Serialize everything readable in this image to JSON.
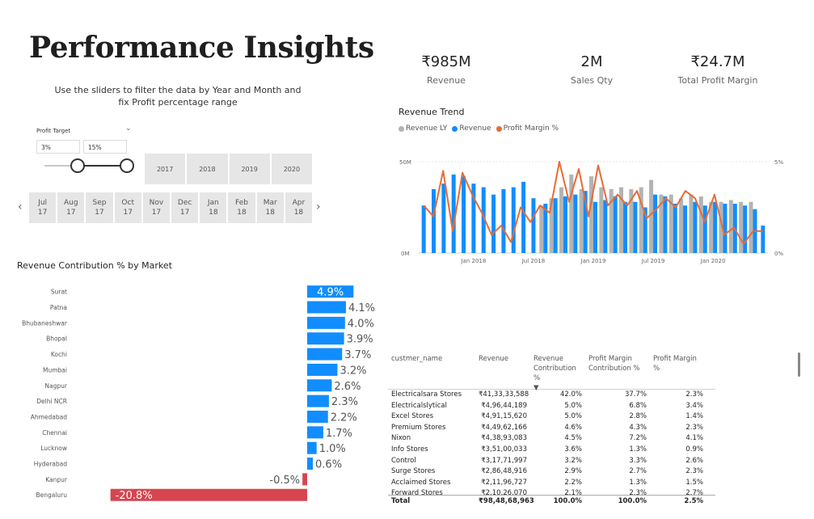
{
  "header": {
    "title": "Performance Insights",
    "instructions": "Use the sliders to filter the data by Year and Month and fix Profit percentage range"
  },
  "profit_target": {
    "label": "Profit Target",
    "min_value": "3%",
    "max_value": "15%"
  },
  "years": [
    "2017",
    "2018",
    "2019",
    "2020"
  ],
  "months": [
    {
      "m": "Jul",
      "y": "17"
    },
    {
      "m": "Aug",
      "y": "17"
    },
    {
      "m": "Sep",
      "y": "17"
    },
    {
      "m": "Oct",
      "y": "17"
    },
    {
      "m": "Nov",
      "y": "17"
    },
    {
      "m": "Dec",
      "y": "17"
    },
    {
      "m": "Jan",
      "y": "18"
    },
    {
      "m": "Feb",
      "y": "18"
    },
    {
      "m": "Mar",
      "y": "18"
    },
    {
      "m": "Apr",
      "y": "18"
    }
  ],
  "kpis": [
    {
      "value": "₹985M",
      "label": "Revenue"
    },
    {
      "value": "2M",
      "label": "Sales Qty"
    },
    {
      "value": "₹24.7M",
      "label": "Total Profit Margin"
    }
  ],
  "colors": {
    "revenue_ly": "#b3b3b3",
    "revenue": "#118dff",
    "profit_margin": "#e66c37",
    "negative": "#d64550",
    "positive": "#118dff"
  },
  "chart_data": [
    {
      "type": "bar",
      "title": "Revenue Trend",
      "legend": [
        "Revenue LY",
        "Revenue",
        "Profit Margin %"
      ],
      "legend_position": "top-left",
      "y_ticks_left": [
        "50M",
        "0M"
      ],
      "y_ticks_right": [
        "5%",
        "0%"
      ],
      "ylim": [
        0,
        50
      ],
      "ylim_right": [
        0,
        5
      ],
      "x_ticks": [
        "Jan 2018",
        "Jul 2018",
        "Jan 2019",
        "Jul 2019",
        "Jan 2020"
      ],
      "x_tick_index": [
        5,
        11,
        17,
        23,
        29
      ],
      "series": [
        {
          "name": "Revenue LY",
          "values": [
            null,
            null,
            null,
            null,
            null,
            null,
            null,
            null,
            null,
            null,
            null,
            null,
            26,
            30,
            36,
            43,
            35,
            42,
            36,
            35,
            36,
            35,
            36,
            40,
            32,
            32,
            30,
            32,
            31,
            28,
            28,
            29,
            28,
            28,
            null
          ]
        },
        {
          "name": "Revenue",
          "values": [
            26,
            35,
            38,
            43,
            42,
            38,
            36,
            32,
            35,
            36,
            39,
            30,
            27,
            30,
            31,
            32,
            34,
            28,
            29,
            31,
            28,
            28,
            25,
            32,
            31,
            27,
            26,
            28,
            26,
            28,
            27,
            27,
            26,
            24,
            15
          ]
        },
        {
          "name": "Profit Margin %",
          "values": [
            2.6,
            2.0,
            4.5,
            1.2,
            4.4,
            3.2,
            2.2,
            1.0,
            1.5,
            0.6,
            2.5,
            1.7,
            2.6,
            2.2,
            5.0,
            2.8,
            4.6,
            2.0,
            4.8,
            2.6,
            3.2,
            2.6,
            3.4,
            1.9,
            2.4,
            3.0,
            2.5,
            3.4,
            3.0,
            1.7,
            3.2,
            1.0,
            1.4,
            0.5,
            1.2,
            1.2
          ]
        }
      ]
    },
    {
      "type": "bar",
      "title": "Revenue Contribution % by Market",
      "categories": [
        "Surat",
        "Patna",
        "Bhubaneshwar",
        "Bhopal",
        "Kochi",
        "Mumbai",
        "Nagpur",
        "Delhi NCR",
        "Ahmedabad",
        "Chennai",
        "Lucknow",
        "Hyderabad",
        "Kanpur",
        "Bengaluru"
      ],
      "values": [
        4.9,
        4.1,
        4.0,
        3.9,
        3.7,
        3.2,
        2.6,
        2.3,
        2.2,
        1.7,
        1.0,
        0.6,
        -0.5,
        -20.8
      ],
      "labels": [
        "4.9%",
        "4.1%",
        "4.0%",
        "3.9%",
        "3.7%",
        "3.2%",
        "2.6%",
        "2.3%",
        "2.2%",
        "1.7%",
        "1.0%",
        "0.6%",
        "-0.5%",
        "-20.8%"
      ]
    }
  ],
  "table": {
    "columns": [
      "custmer_name",
      "Revenue",
      "Revenue Contribution %",
      "Profit Margin Contribution %",
      "Profit Margin %"
    ],
    "sort_indicator": "▼",
    "rows": [
      [
        "Electricalsara Stores",
        "₹41,33,33,588",
        "42.0%",
        "37.7%",
        "2.3%"
      ],
      [
        "Electricalslytical",
        "₹4,96,44,189",
        "5.0%",
        "6.8%",
        "3.4%"
      ],
      [
        "Excel Stores",
        "₹4,91,15,620",
        "5.0%",
        "2.8%",
        "1.4%"
      ],
      [
        "Premium Stores",
        "₹4,49,62,166",
        "4.6%",
        "4.3%",
        "2.3%"
      ],
      [
        "Nixon",
        "₹4,38,93,083",
        "4.5%",
        "7.2%",
        "4.1%"
      ],
      [
        "Info Stores",
        "₹3,51,00,033",
        "3.6%",
        "1.3%",
        "0.9%"
      ],
      [
        "Control",
        "₹3,17,71,997",
        "3.2%",
        "3.3%",
        "2.6%"
      ],
      [
        "Surge Stores",
        "₹2,86,48,916",
        "2.9%",
        "2.7%",
        "2.3%"
      ],
      [
        "Acclaimed Stores",
        "₹2,11,96,727",
        "2.2%",
        "1.3%",
        "1.5%"
      ],
      [
        "Forward Stores",
        "₹2,10,26,070",
        "2.1%",
        "2.3%",
        "2.7%"
      ]
    ],
    "total": [
      "Total",
      "₹98,48,68,963",
      "100.0%",
      "100.0%",
      "2.5%"
    ]
  }
}
